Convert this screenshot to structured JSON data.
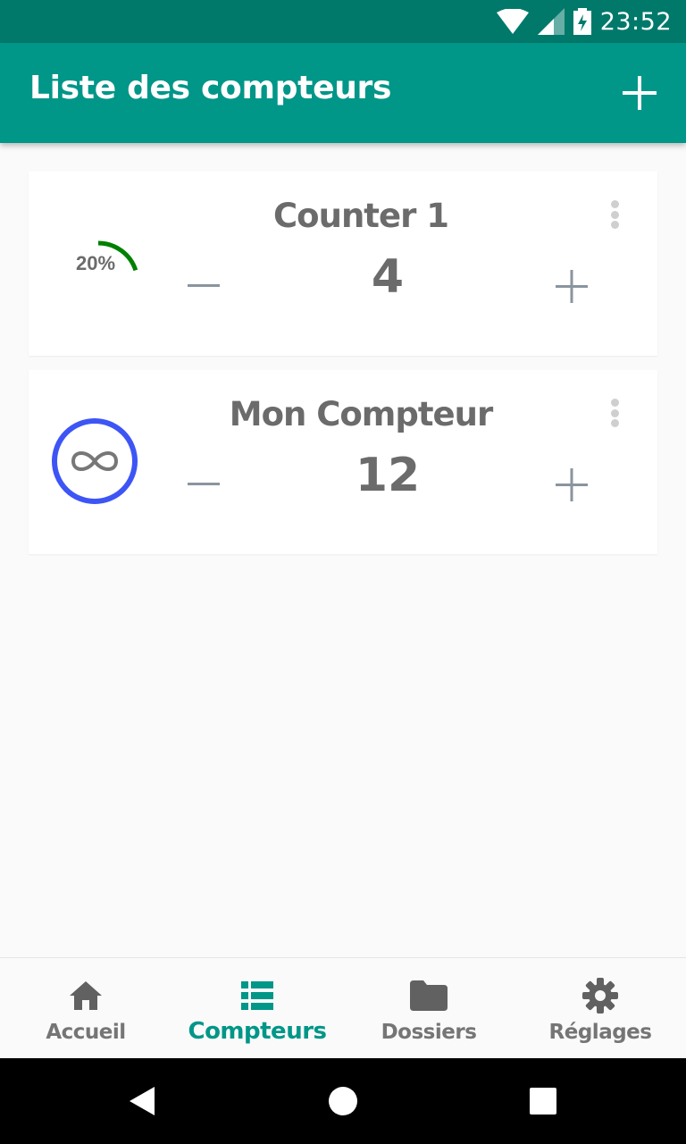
{
  "status_bar": {
    "time": "23:52",
    "icons": [
      "wifi-icon",
      "cell-signal-icon",
      "battery-charging-icon"
    ]
  },
  "app_bar": {
    "title": "Liste des compteurs",
    "add_icon": "plus-icon"
  },
  "counters": [
    {
      "name": "Counter 1",
      "value": "4",
      "indicator": {
        "type": "progress",
        "progress": 0.2,
        "label": "20%",
        "color": "#008000"
      },
      "minus_icon": "minus-icon",
      "plus_icon": "plus-icon",
      "menu_icon": "more-vert-icon"
    },
    {
      "name": "Mon Compteur",
      "value": "12",
      "indicator": {
        "type": "infinite",
        "icon": "infinity-icon",
        "color": "#3d55f5"
      },
      "minus_icon": "minus-icon",
      "plus_icon": "plus-icon",
      "menu_icon": "more-vert-icon"
    }
  ],
  "bottom_nav": {
    "items": [
      {
        "label": "Accueil",
        "icon": "home-icon",
        "active": false
      },
      {
        "label": "Compteurs",
        "icon": "list-icon",
        "active": true
      },
      {
        "label": "Dossiers",
        "icon": "folder-icon",
        "active": false
      },
      {
        "label": "Réglages",
        "icon": "gear-icon",
        "active": false
      }
    ]
  },
  "system_nav": {
    "icons": [
      "back-icon",
      "home-circle-icon",
      "recents-icon"
    ]
  },
  "colors": {
    "primary": "#009688",
    "primary_dark": "#00796b",
    "text": "#6b6b6b",
    "icon_gray": "#8a959e",
    "background": "#fafafa"
  }
}
